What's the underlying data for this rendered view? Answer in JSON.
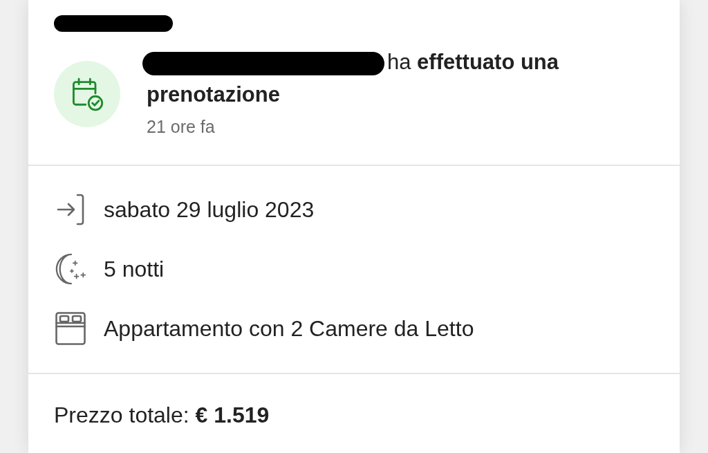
{
  "header": {
    "name_redacted": true
  },
  "notification": {
    "actor_redacted": true,
    "text": "ha **effettuato una prenotazione**",
    "time": "21 ore fa"
  },
  "details": [
    {
      "kind": "check_in",
      "text": "sabato 29 luglio 2023"
    },
    {
      "kind": "nights",
      "text": "5 notti"
    },
    {
      "kind": "room",
      "text": "Appartamento con 2 Camere da Letto"
    }
  ],
  "total": "Prezzo totale: **€ 1.519**"
}
